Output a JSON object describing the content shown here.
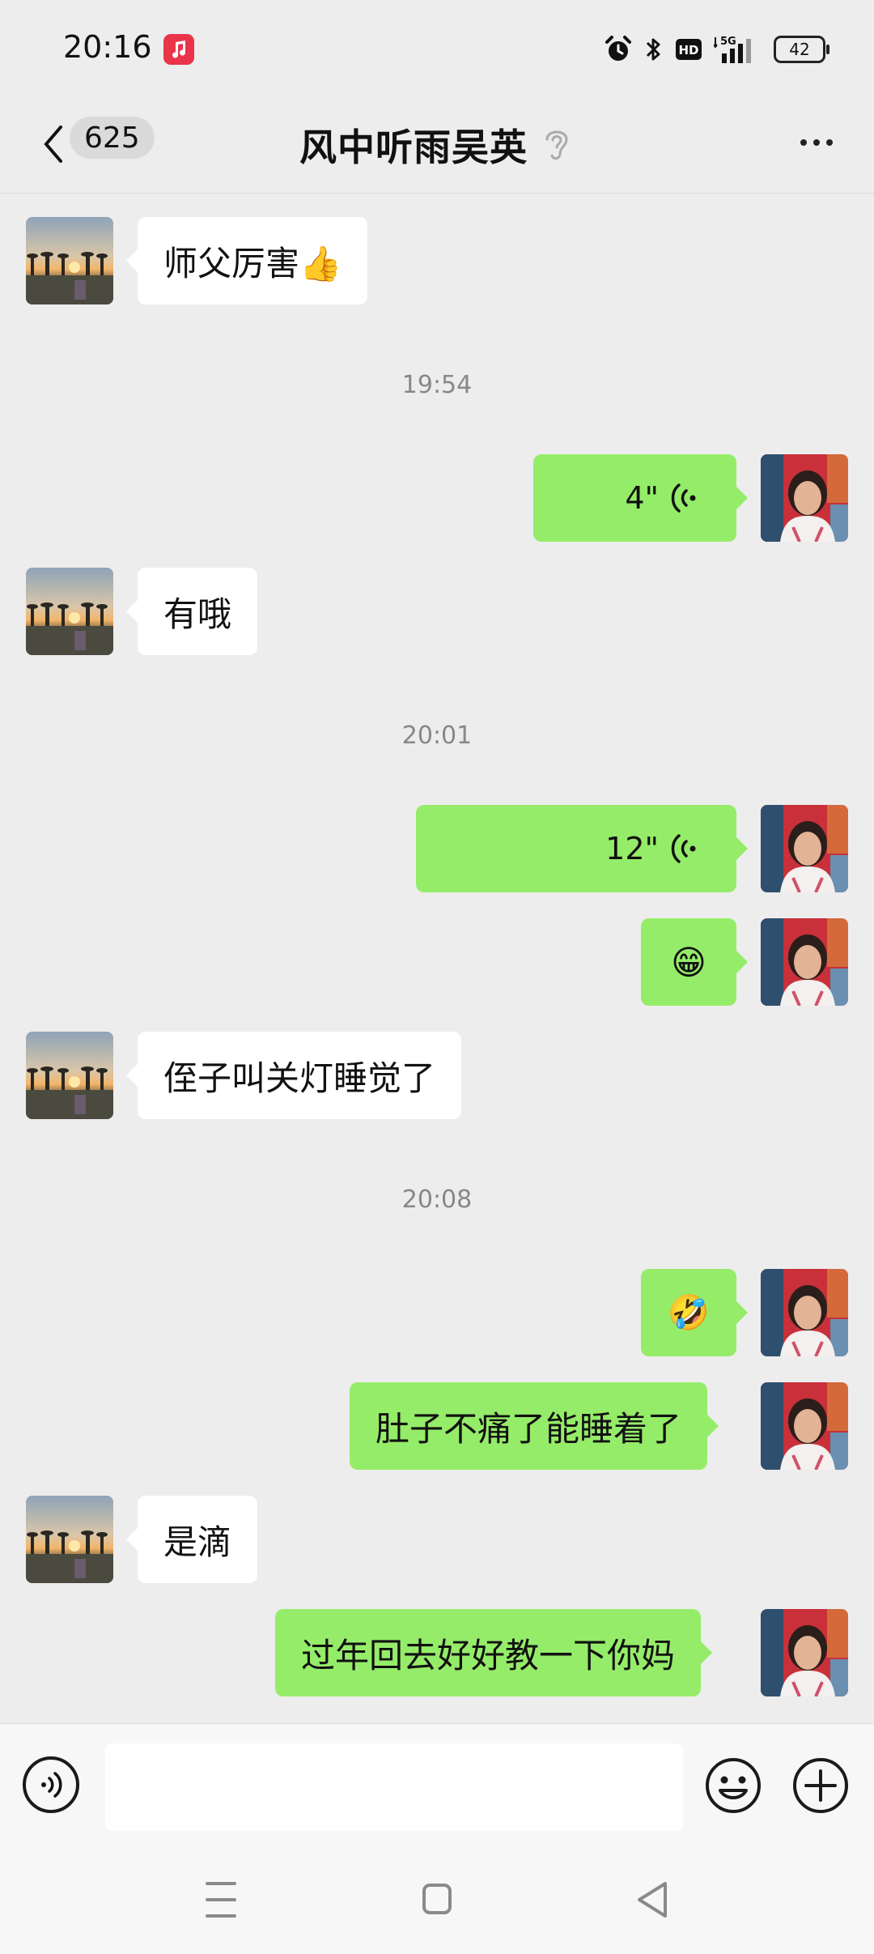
{
  "status_bar": {
    "time": "20:16",
    "battery": "42",
    "icons": [
      "music-app-icon",
      "alarm-icon",
      "bluetooth-icon",
      "hd-icon",
      "5g-signal-icon",
      "battery-icon"
    ]
  },
  "header": {
    "unread_count": "625",
    "title": "风中听雨吴英"
  },
  "messages": [
    {
      "type": "in",
      "text": "师父厉害👍"
    },
    {
      "type": "time",
      "text": "19:54"
    },
    {
      "type": "out_voice",
      "duration": "4\""
    },
    {
      "type": "in",
      "text": "有哦"
    },
    {
      "type": "time",
      "text": "20:01"
    },
    {
      "type": "out_voice",
      "duration": "12\""
    },
    {
      "type": "out",
      "text": "😁"
    },
    {
      "type": "in",
      "text": "侄子叫关灯睡觉了"
    },
    {
      "type": "time",
      "text": "20:08"
    },
    {
      "type": "out",
      "text": "🤣"
    },
    {
      "type": "out",
      "text": "肚子不痛了能睡着了"
    },
    {
      "type": "in",
      "text": "是滴"
    },
    {
      "type": "out",
      "text": "过年回去好好教一下你妈"
    }
  ],
  "input": {
    "value": ""
  },
  "colors": {
    "outgoing_bubble": "#95ec69",
    "incoming_bubble": "#ffffff",
    "background": "#ededed"
  }
}
